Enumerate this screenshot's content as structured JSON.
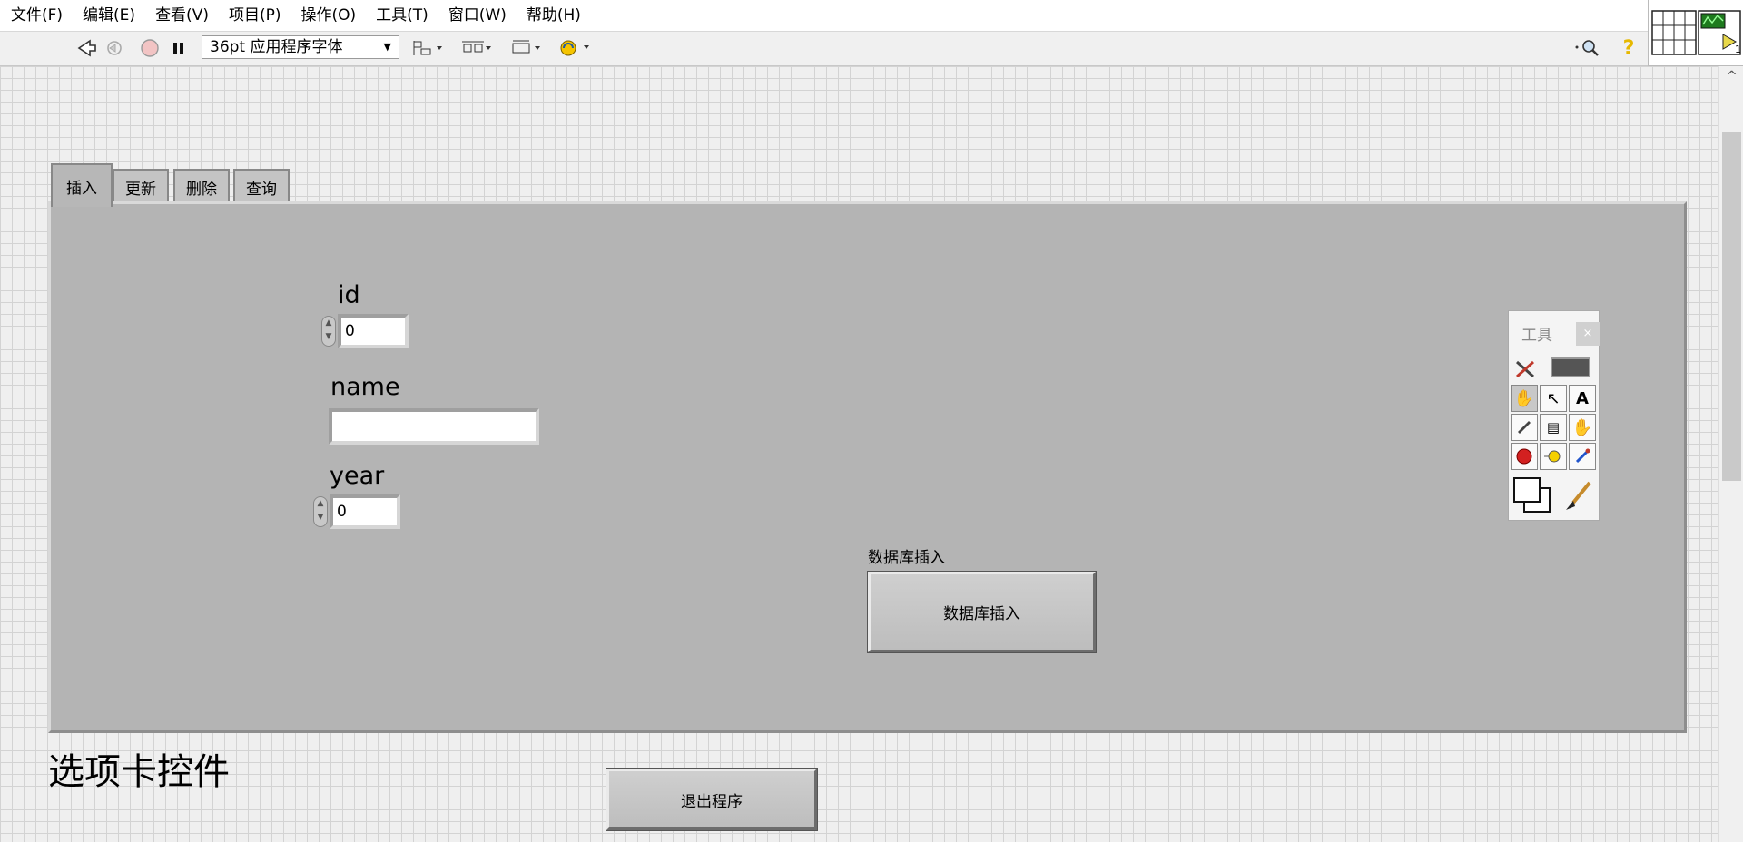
{
  "menu": [
    "文件(F)",
    "编辑(E)",
    "查看(V)",
    "项目(P)",
    "操作(O)",
    "工具(T)",
    "窗口(W)",
    "帮助(H)"
  ],
  "toolbar": {
    "font": "36pt 应用程序字体",
    "help": "?"
  },
  "tabs": [
    "插入",
    "更新",
    "删除",
    "查询"
  ],
  "fields": {
    "id_label": "id",
    "id_value": "0",
    "name_label": "name",
    "name_value": "",
    "year_label": "year",
    "year_value": "0"
  },
  "insert_button": {
    "caption": "数据库插入",
    "label": "数据库插入"
  },
  "tab_control_label": "选项卡控件",
  "exit_button": "退出程序",
  "tools_palette": {
    "title": "工具",
    "close": "×"
  }
}
